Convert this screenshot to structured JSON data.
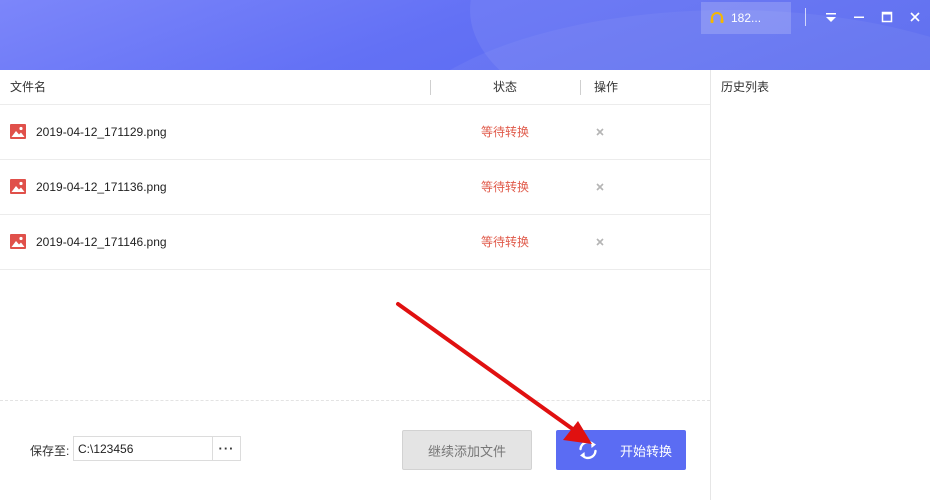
{
  "header": {
    "user_label": "182...",
    "colors": {
      "gradient_start": "#7c86fa",
      "gradient_end": "#5566ee"
    },
    "icons": [
      "headset-icon",
      "dropdown-menu-icon",
      "minimize-icon",
      "maximize-icon",
      "close-icon"
    ]
  },
  "table": {
    "columns": {
      "filename": "文件名",
      "status": "状态",
      "action": "操作"
    },
    "rows": [
      {
        "filename": "2019-04-12_171129.png",
        "status": "等待转换"
      },
      {
        "filename": "2019-04-12_171136.png",
        "status": "等待转换"
      },
      {
        "filename": "2019-04-12_171146.png",
        "status": "等待转换"
      }
    ],
    "status_color": "#e05a4a"
  },
  "footer": {
    "save_label": "保存至:",
    "save_path": "C:\\123456",
    "browse_label": "···",
    "add_files_label": "继续添加文件",
    "start_label": "开始转换",
    "accent_color": "#5b6cf3"
  },
  "history": {
    "title": "历史列表"
  },
  "annotation": {
    "arrow_color": "#e01010"
  }
}
